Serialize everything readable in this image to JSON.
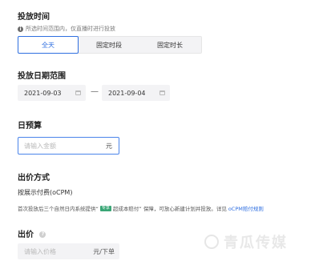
{
  "schedule": {
    "title": "投放时间",
    "hint": "所选时间范围内，仅直播时进行投放",
    "options": [
      "全天",
      "固定时段",
      "固定时长"
    ],
    "selected": "全天"
  },
  "date_range": {
    "title": "投放日期范围",
    "start": "2021-09-03",
    "separator": "—",
    "end": "2021-09-04"
  },
  "budget": {
    "title": "日预算",
    "placeholder": "请输入金额",
    "unit": "元"
  },
  "bidding": {
    "title": "出价方式",
    "method": "按展示付费(oCPM)",
    "notice_before": "首次投放后三个自然日内系统提供“",
    "notice_badge": "专享",
    "notice_after": " 超成本赔付” 保障，可放心新建计划并投放。详见",
    "notice_link": "oCPM赔付规则"
  },
  "bid": {
    "title": "出价",
    "placeholder": "请输入价格",
    "unit": "元/下单"
  },
  "watermark": {
    "text": "青瓜传媒"
  },
  "colors": {
    "accent": "#2f6fe0",
    "badge": "#3aa676"
  }
}
